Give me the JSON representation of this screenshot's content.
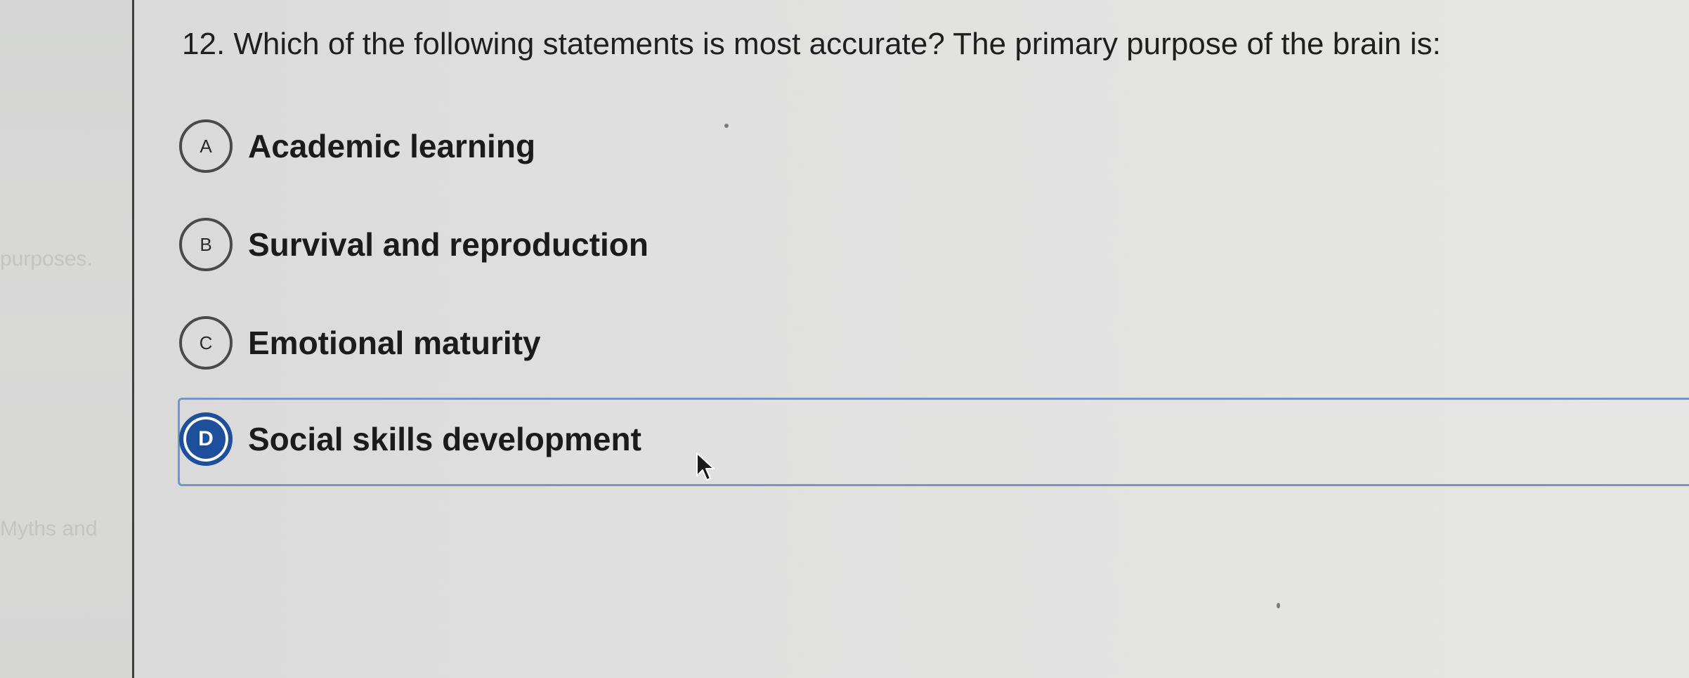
{
  "left_panel": {
    "ghost_texts": [
      "purposes.",
      "Myths and"
    ]
  },
  "question": {
    "text": "12. Which of the following statements is most accurate? The primary purpose of the brain is:"
  },
  "options": [
    {
      "letter": "A",
      "label": "Academic learning",
      "selected": false
    },
    {
      "letter": "B",
      "label": "Survival and reproduction",
      "selected": false
    },
    {
      "letter": "C",
      "label": "Emotional maturity",
      "selected": false
    },
    {
      "letter": "D",
      "label": "Social skills development",
      "selected": true
    }
  ],
  "colors": {
    "selected_accent": "#1d4f9c",
    "selected_border": "#6f98c6",
    "background": "#e0e0e0"
  },
  "icons": {
    "cursor": "mouse-pointer-icon"
  }
}
